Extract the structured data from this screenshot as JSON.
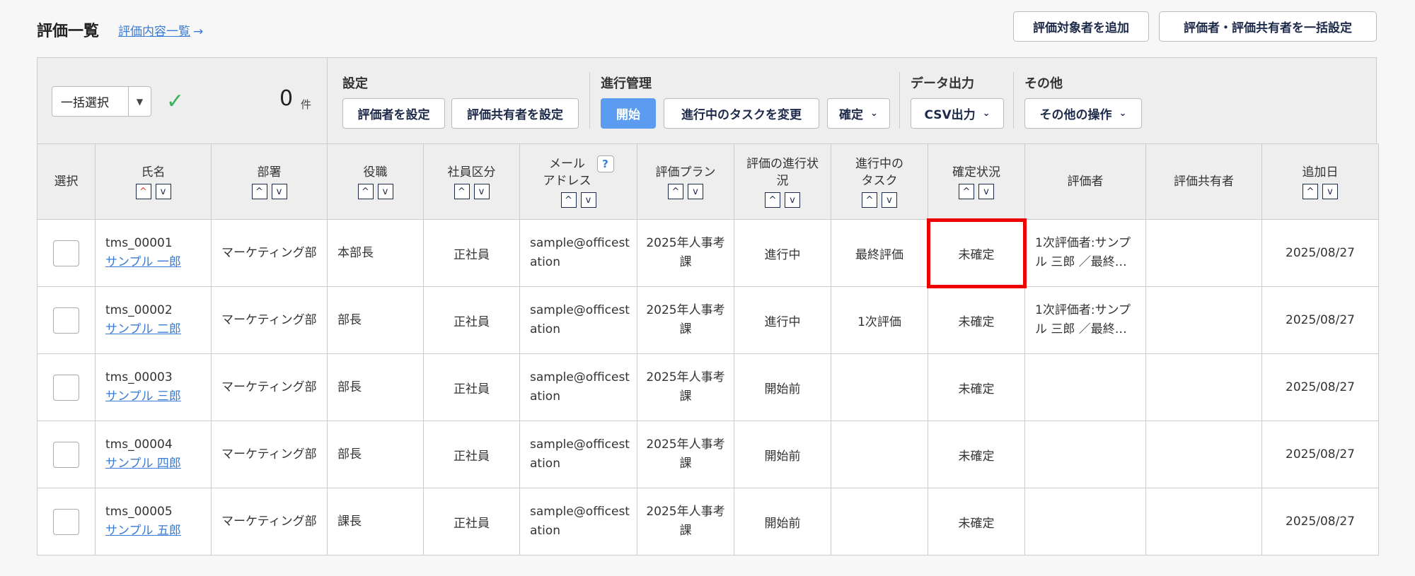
{
  "header": {
    "title": "評価一覧",
    "link_label": "評価内容一覧",
    "link_arrow": "→",
    "add_target_button": "評価対象者を追加",
    "bulk_set_button": "評価者・評価共有者を一括設定"
  },
  "panel": {
    "bulk_select_label": "一括選択",
    "bulk_select_icon": "▼",
    "check_icon": "✓",
    "count_value": "0",
    "count_unit": "件",
    "groups": {
      "settings": {
        "label": "設定",
        "buttons": [
          "評価者を設定",
          "評価共有者を設定"
        ]
      },
      "progress": {
        "label": "進行管理",
        "start": "開始",
        "change_task": "進行中のタスクを変更",
        "confirm": "確定"
      },
      "export": {
        "label": "データ出力",
        "csv": "CSV出力"
      },
      "other": {
        "label": "その他",
        "other_ops": "その他の操作"
      }
    },
    "chevron": "⌄"
  },
  "table": {
    "headers": {
      "select": "選択",
      "name": "氏名",
      "dept": "部署",
      "position": "役職",
      "emp_type": "社員区分",
      "email_l1": "メール",
      "email_l2": "アドレス",
      "plan": "評価プラン",
      "progress": "評価の進行状況",
      "task": "進行中のタスク",
      "confirm_status": "確定状況",
      "evaluator": "評価者",
      "sharer": "評価共有者",
      "added_date": "追加日"
    },
    "help_icon": "?",
    "sort_up": "^",
    "sort_down": "v",
    "rows": [
      {
        "id": "tms_00001",
        "name": "サンプル 一郎",
        "dept": "マーケティング部",
        "position": "本部長",
        "emp_type": "正社員",
        "email": "sample@officestation",
        "plan": "2025年人事考課",
        "progress": "進行中",
        "task": "最終評価",
        "confirm_status": "未確定",
        "evaluator": "1次評価者:サンプル 三郎 ／最終…",
        "sharer": "",
        "added_date": "2025/08/27"
      },
      {
        "id": "tms_00002",
        "name": "サンプル 二郎",
        "dept": "マーケティング部",
        "position": "部長",
        "emp_type": "正社員",
        "email": "sample@officestation",
        "plan": "2025年人事考課",
        "progress": "進行中",
        "task": "1次評価",
        "confirm_status": "未確定",
        "evaluator": "1次評価者:サンプル 三郎 ／最終…",
        "sharer": "",
        "added_date": "2025/08/27"
      },
      {
        "id": "tms_00003",
        "name": "サンプル 三郎",
        "dept": "マーケティング部",
        "position": "部長",
        "emp_type": "正社員",
        "email": "sample@officestation",
        "plan": "2025年人事考課",
        "progress": "開始前",
        "task": "",
        "confirm_status": "未確定",
        "evaluator": "",
        "sharer": "",
        "added_date": "2025/08/27"
      },
      {
        "id": "tms_00004",
        "name": "サンプル 四郎",
        "dept": "マーケティング部",
        "position": "部長",
        "emp_type": "正社員",
        "email": "sample@officestation",
        "plan": "2025年人事考課",
        "progress": "開始前",
        "task": "",
        "confirm_status": "未確定",
        "evaluator": "",
        "sharer": "",
        "added_date": "2025/08/27"
      },
      {
        "id": "tms_00005",
        "name": "サンプル 五郎",
        "dept": "マーケティング部",
        "position": "課長",
        "emp_type": "正社員",
        "email": "sample@officestation",
        "plan": "2025年人事考課",
        "progress": "開始前",
        "task": "",
        "confirm_status": "未確定",
        "evaluator": "",
        "sharer": "",
        "added_date": "2025/08/27"
      }
    ]
  },
  "colors": {
    "accent": "#5b9cf0",
    "link": "#3a7bd5",
    "highlight": "#e00000",
    "check": "#3bb05a"
  }
}
